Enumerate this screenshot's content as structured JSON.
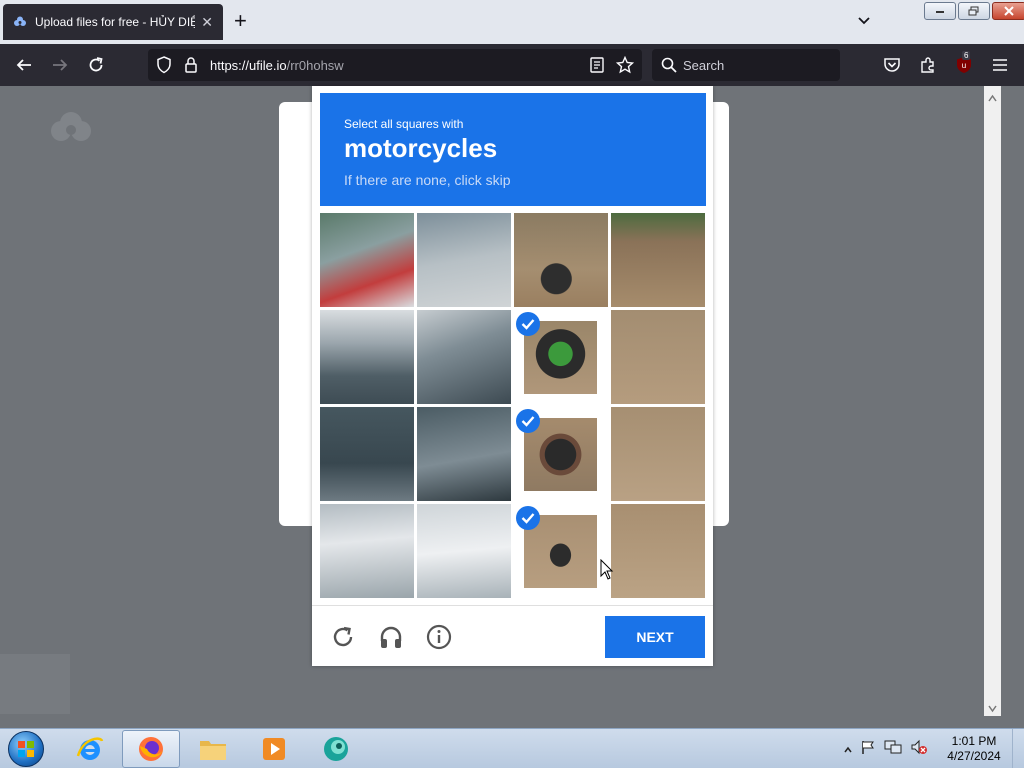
{
  "browser": {
    "tab_title": "Upload files for free - HỦY DIỆT",
    "url_host": "https://ufile.io",
    "url_path": "/rr0hohsw",
    "search_placeholder": "Search",
    "extension_badge": "6"
  },
  "captcha": {
    "instruction": "Select all squares with",
    "target": "motorcycles",
    "hint": "If there are none, click skip",
    "next_label": "NEXT",
    "selected_tiles": [
      6,
      10,
      14
    ]
  },
  "taskbar": {
    "time": "1:01 PM",
    "date": "4/27/2024"
  },
  "colors": {
    "accent": "#1a73e8",
    "browser_dark": "#2b2a33"
  }
}
